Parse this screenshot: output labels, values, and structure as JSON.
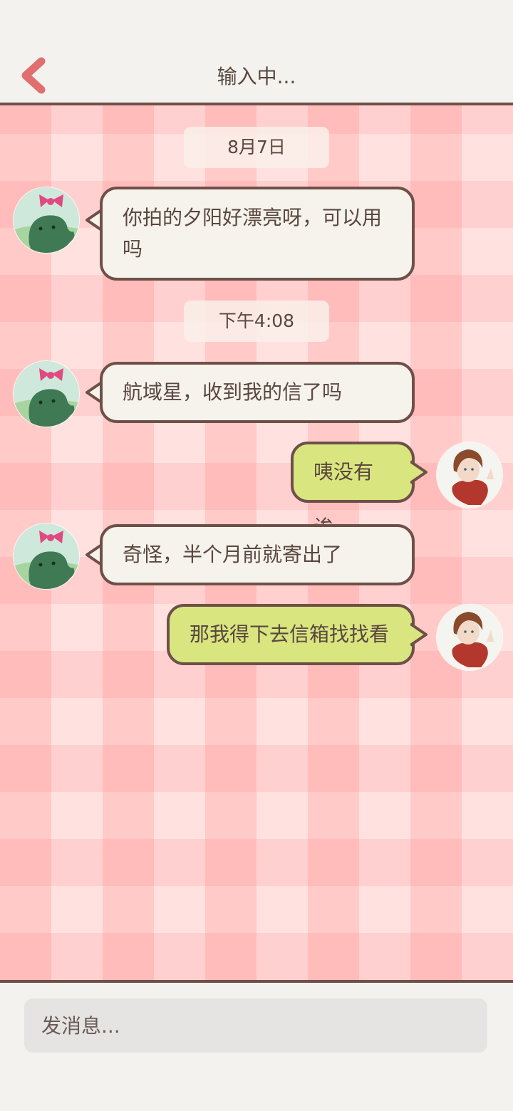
{
  "header": {
    "title": "输入中..."
  },
  "messages": [
    {
      "type": "time",
      "text": "8月7日"
    },
    {
      "type": "incoming",
      "sender_icon": "dino-avatar-icon",
      "text": "你拍的夕阳好漂亮呀，可以用吗",
      "line1": "你拍的夕阳好漂亮呀，可以用",
      "line2": "吗"
    },
    {
      "type": "time",
      "text": "下午4:08"
    },
    {
      "type": "incoming",
      "sender_icon": "dino-avatar-icon",
      "text": "航域星，收到我的信了吗"
    },
    {
      "type": "outgoing",
      "sender_icon": "user-avatar-icon",
      "text": "咦没有诶"
    },
    {
      "type": "incoming",
      "sender_icon": "dino-avatar-icon",
      "text": "奇怪，半个月前就寄出了"
    },
    {
      "type": "outgoing",
      "sender_icon": "user-avatar-icon",
      "text": "那我得下去信箱找找看"
    }
  ],
  "input": {
    "placeholder": "发消息..."
  },
  "colors": {
    "accent_back": "#e07070",
    "border": "#6e5048",
    "incoming_bubble": "#f6f2ec",
    "outgoing_bubble": "#d9e57f",
    "chat_background": "#ffd9d6"
  }
}
